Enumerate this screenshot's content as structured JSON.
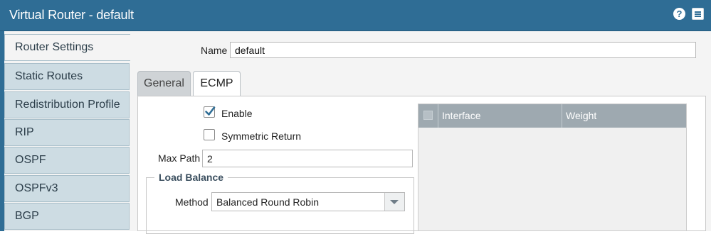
{
  "window": {
    "title": "Virtual Router - default"
  },
  "sidebar": {
    "items": [
      {
        "label": "Router Settings",
        "active": true
      },
      {
        "label": "Static Routes"
      },
      {
        "label": "Redistribution Profile"
      },
      {
        "label": "RIP"
      },
      {
        "label": "OSPF"
      },
      {
        "label": "OSPFv3"
      },
      {
        "label": "BGP"
      }
    ]
  },
  "form": {
    "name_label": "Name",
    "name_value": "default",
    "tabs": [
      {
        "label": "General"
      },
      {
        "label": "ECMP",
        "active": true
      }
    ],
    "ecmp": {
      "enable_label": "Enable",
      "enable_checked": true,
      "symmetric_label": "Symmetric Return",
      "symmetric_checked": false,
      "max_path_label": "Max Path",
      "max_path_value": "2",
      "load_balance_legend": "Load Balance",
      "method_label": "Method",
      "method_value": "Balanced Round Robin"
    },
    "interface_table": {
      "columns": [
        "Interface",
        "Weight"
      ]
    }
  },
  "icons": {
    "help": "help-icon",
    "menu": "menu-icon",
    "checkmark": "checkmark-icon",
    "dropdown": "chevron-down-icon"
  },
  "colors": {
    "titlebar": "#2f6d95",
    "sidebar_item": "#cddce3",
    "grid_header": "#9ea9b0",
    "check": "#2f6d95"
  }
}
